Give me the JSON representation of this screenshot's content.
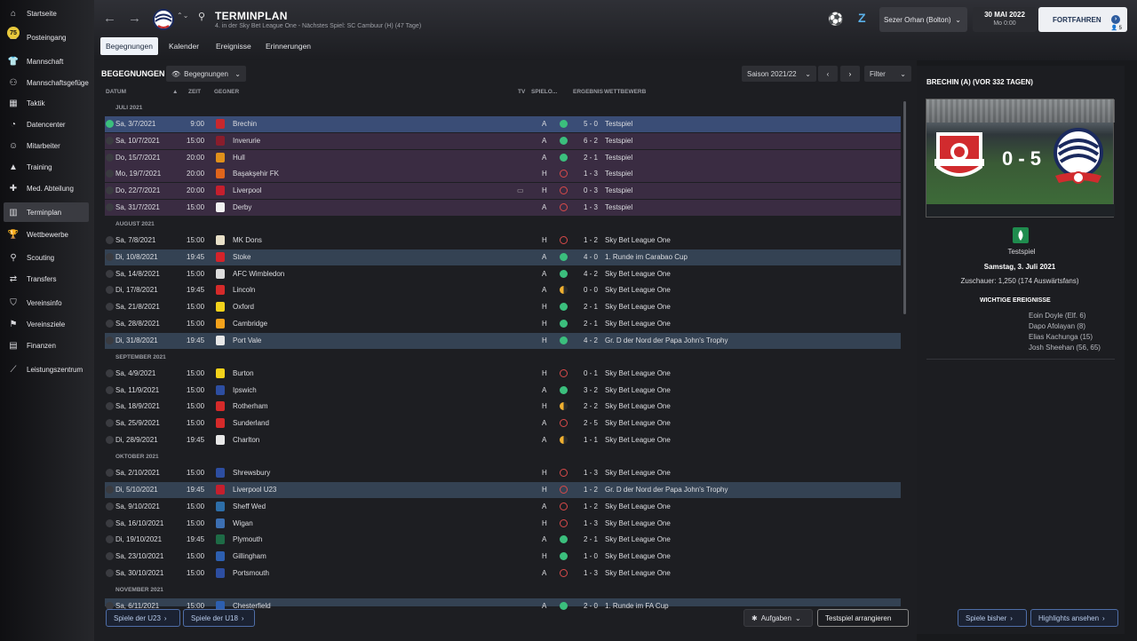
{
  "sidebar": {
    "items": [
      {
        "label": "Startseite",
        "icon": "home-icon",
        "glyph": "⌂"
      },
      {
        "label": "Posteingang",
        "icon": "inbox-icon",
        "glyph": "✉",
        "badge": "75"
      },
      {
        "label": "Mannschaft",
        "icon": "shirt-icon",
        "glyph": "👕"
      },
      {
        "label": "Mannschaftsgefüge",
        "icon": "dynamics-icon",
        "glyph": "⚇"
      },
      {
        "label": "Taktik",
        "icon": "tactics-icon",
        "glyph": "▦"
      },
      {
        "label": "Datencenter",
        "icon": "data-icon",
        "glyph": "◔"
      },
      {
        "label": "Mitarbeiter",
        "icon": "staff-icon",
        "glyph": "☺"
      },
      {
        "label": "Training",
        "icon": "training-icon",
        "glyph": "▲"
      },
      {
        "label": "Med. Abteilung",
        "icon": "medical-icon",
        "glyph": "✚"
      },
      {
        "label": "Terminplan",
        "icon": "calendar-icon",
        "glyph": "▥"
      },
      {
        "label": "Wettbewerbe",
        "icon": "trophy-icon",
        "glyph": "🏆"
      },
      {
        "label": "Scouting",
        "icon": "scouting-icon",
        "glyph": "⚲"
      },
      {
        "label": "Transfers",
        "icon": "transfers-icon",
        "glyph": "⇄"
      },
      {
        "label": "Vereinsinfo",
        "icon": "club-info-icon",
        "glyph": "⛉"
      },
      {
        "label": "Vereinsziele",
        "icon": "club-vision-icon",
        "glyph": "⚑"
      },
      {
        "label": "Finanzen",
        "icon": "finances-icon",
        "glyph": "▤"
      },
      {
        "label": "Leistungszentrum",
        "icon": "development-icon",
        "glyph": "⟋"
      }
    ]
  },
  "header": {
    "title": "TERMINPLAN",
    "subtitle": "4. in der Sky Bet League One - Nächstes Spiel: SC Cambuur (H) (47 Tage)",
    "manager": "Sezer Orhan (Bolton)",
    "date": "30 MAI 2022",
    "time": "Mo 0:00",
    "continue": "FORTFAHREN",
    "count": "5",
    "tabs": [
      "Begegnungen",
      "Kalender",
      "Ereignisse",
      "Erinnerungen"
    ]
  },
  "fixtures": {
    "section": "BEGEGNUNGEN",
    "view": "Begegnungen",
    "season": "Saison 2021/22",
    "filter": "Filter",
    "cols": {
      "datum": "DATUM",
      "zeit": "ZEIT",
      "gegner": "GEGNER",
      "tv": "TV",
      "spielort": "SPIELO...",
      "ergebnis": "ERGEBNIS",
      "wettbewerb": "WETTBEWERB"
    },
    "months": [
      "JULI 2021",
      "AUGUST 2021",
      "SEPTEMBER 2021",
      "OKTOBER 2021",
      "NOVEMBER 2021"
    ],
    "rows": [
      {
        "date": "Sa, 3/7/2021",
        "time": "9:00",
        "opp": "Brechin",
        "v": "A",
        "r": "w",
        "score": "5 - 0",
        "comp": "Testspiel",
        "bg": "sel",
        "crest": "#c8282d"
      },
      {
        "date": "Sa, 10/7/2021",
        "time": "15:00",
        "opp": "Inverurie",
        "v": "A",
        "r": "w",
        "score": "6 - 2",
        "comp": "Testspiel",
        "bg": "purple",
        "crest": "#8a1d2c"
      },
      {
        "date": "Do, 15/7/2021",
        "time": "20:00",
        "opp": "Hull",
        "v": "A",
        "r": "w",
        "score": "2 - 1",
        "comp": "Testspiel",
        "bg": "purple",
        "crest": "#e0901b"
      },
      {
        "date": "Mo, 19/7/2021",
        "time": "20:00",
        "opp": "Başakşehir FK",
        "v": "H",
        "r": "l",
        "score": "1 - 3",
        "comp": "Testspiel",
        "bg": "purple",
        "crest": "#e0651b"
      },
      {
        "date": "Do, 22/7/2021",
        "time": "20:00",
        "opp": "Liverpool",
        "v": "H",
        "r": "l",
        "score": "0 - 3",
        "comp": "Testspiel",
        "bg": "purple",
        "crest": "#c51f2d",
        "tv": true
      },
      {
        "date": "Sa, 31/7/2021",
        "time": "15:00",
        "opp": "Derby",
        "v": "A",
        "r": "l",
        "score": "1 - 3",
        "comp": "Testspiel",
        "bg": "purple",
        "crest": "#f1f1f1"
      },
      {
        "date": "Sa, 7/8/2021",
        "time": "15:00",
        "opp": "MK Dons",
        "v": "H",
        "r": "l",
        "score": "1 - 2",
        "comp": "Sky Bet League One",
        "bg": "plain",
        "crest": "#e8e0c8"
      },
      {
        "date": "Di, 10/8/2021",
        "time": "19:45",
        "opp": "Stoke",
        "v": "A",
        "r": "w",
        "score": "4 - 0",
        "comp": "1. Runde im Carabao Cup",
        "bg": "blue",
        "crest": "#d5232a"
      },
      {
        "date": "Sa, 14/8/2021",
        "time": "15:00",
        "opp": "AFC Wimbledon",
        "v": "A",
        "r": "w",
        "score": "4 - 2",
        "comp": "Sky Bet League One",
        "bg": "plain",
        "crest": "#dcdcdc"
      },
      {
        "date": "Di, 17/8/2021",
        "time": "19:45",
        "opp": "Lincoln",
        "v": "A",
        "r": "d",
        "score": "0 - 0",
        "comp": "Sky Bet League One",
        "bg": "plain",
        "crest": "#d52a2a"
      },
      {
        "date": "Sa, 21/8/2021",
        "time": "15:00",
        "opp": "Oxford",
        "v": "H",
        "r": "w",
        "score": "2 - 1",
        "comp": "Sky Bet League One",
        "bg": "plain",
        "crest": "#f2d21b"
      },
      {
        "date": "Sa, 28/8/2021",
        "time": "15:00",
        "opp": "Cambridge",
        "v": "H",
        "r": "w",
        "score": "2 - 1",
        "comp": "Sky Bet League One",
        "bg": "plain",
        "crest": "#f2a11b"
      },
      {
        "date": "Di, 31/8/2021",
        "time": "19:45",
        "opp": "Port Vale",
        "v": "H",
        "r": "w",
        "score": "4 - 2",
        "comp": "Gr. D der Nord der Papa John's Trophy",
        "bg": "blue",
        "crest": "#e8e8e8"
      },
      {
        "date": "Sa, 4/9/2021",
        "time": "15:00",
        "opp": "Burton",
        "v": "H",
        "r": "l",
        "score": "0 - 1",
        "comp": "Sky Bet League One",
        "bg": "plain",
        "crest": "#f2d21b"
      },
      {
        "date": "Sa, 11/9/2021",
        "time": "15:00",
        "opp": "Ipswich",
        "v": "A",
        "r": "w",
        "score": "3 - 2",
        "comp": "Sky Bet League One",
        "bg": "plain",
        "crest": "#2d4ea1"
      },
      {
        "date": "Sa, 18/9/2021",
        "time": "15:00",
        "opp": "Rotherham",
        "v": "H",
        "r": "d",
        "score": "2 - 2",
        "comp": "Sky Bet League One",
        "bg": "plain",
        "crest": "#d52a2a"
      },
      {
        "date": "Sa, 25/9/2021",
        "time": "15:00",
        "opp": "Sunderland",
        "v": "A",
        "r": "l",
        "score": "2 - 5",
        "comp": "Sky Bet League One",
        "bg": "plain",
        "crest": "#d52a2a"
      },
      {
        "date": "Di, 28/9/2021",
        "time": "19:45",
        "opp": "Charlton",
        "v": "A",
        "r": "d",
        "score": "1 - 1",
        "comp": "Sky Bet League One",
        "bg": "plain",
        "crest": "#e8e8e8"
      },
      {
        "date": "Sa, 2/10/2021",
        "time": "15:00",
        "opp": "Shrewsbury",
        "v": "H",
        "r": "l",
        "score": "1 - 3",
        "comp": "Sky Bet League One",
        "bg": "plain",
        "crest": "#2d4ea1"
      },
      {
        "date": "Di, 5/10/2021",
        "time": "19:45",
        "opp": "Liverpool U23",
        "v": "H",
        "r": "l",
        "score": "1 - 2",
        "comp": "Gr. D der Nord der Papa John's Trophy",
        "bg": "blue",
        "crest": "#c51f2d"
      },
      {
        "date": "Sa, 9/10/2021",
        "time": "15:00",
        "opp": "Sheff Wed",
        "v": "A",
        "r": "l",
        "score": "1 - 2",
        "comp": "Sky Bet League One",
        "bg": "plain",
        "crest": "#2d6ea8"
      },
      {
        "date": "Sa, 16/10/2021",
        "time": "15:00",
        "opp": "Wigan",
        "v": "H",
        "r": "l",
        "score": "1 - 3",
        "comp": "Sky Bet League One",
        "bg": "plain",
        "crest": "#3c6fb2"
      },
      {
        "date": "Di, 19/10/2021",
        "time": "19:45",
        "opp": "Plymouth",
        "v": "A",
        "r": "w",
        "score": "2 - 1",
        "comp": "Sky Bet League One",
        "bg": "plain",
        "crest": "#1e6b46"
      },
      {
        "date": "Sa, 23/10/2021",
        "time": "15:00",
        "opp": "Gillingham",
        "v": "H",
        "r": "w",
        "score": "1 - 0",
        "comp": "Sky Bet League One",
        "bg": "plain",
        "crest": "#2d5fb0"
      },
      {
        "date": "Sa, 30/10/2021",
        "time": "15:00",
        "opp": "Portsmouth",
        "v": "A",
        "r": "l",
        "score": "1 - 3",
        "comp": "Sky Bet League One",
        "bg": "plain",
        "crest": "#2d4ea1"
      },
      {
        "date": "Sa, 6/11/2021",
        "time": "15:00",
        "opp": "Chesterfield",
        "v": "A",
        "r": "w",
        "score": "2 - 0",
        "comp": "1. Runde im FA Cup",
        "bg": "blue",
        "crest": "#2d5fb0"
      }
    ]
  },
  "detail": {
    "title": "BRECHIN (A) (VOR 332 TAGEN)",
    "score": "0 - 5",
    "competition": "Testspiel",
    "date": "Samstag, 3. Juli 2021",
    "attendance": "Zuschauer: 1,250 (174 Auswärtsfans)",
    "events_title": "WICHTIGE EREIGNISSE",
    "events": [
      "Eoin Doyle (Elf. 6)",
      "Dapo Afolayan (8)",
      "Elias Kachunga (15)",
      "Josh Sheehan (56, 65)"
    ]
  },
  "bottom": {
    "u23": "Spiele der U23",
    "u18": "Spiele der U18",
    "aufgaben": "Aufgaben",
    "arrange": "Testspiel arrangieren",
    "previous": "Spiele bisher",
    "highlights": "Highlights ansehen"
  }
}
